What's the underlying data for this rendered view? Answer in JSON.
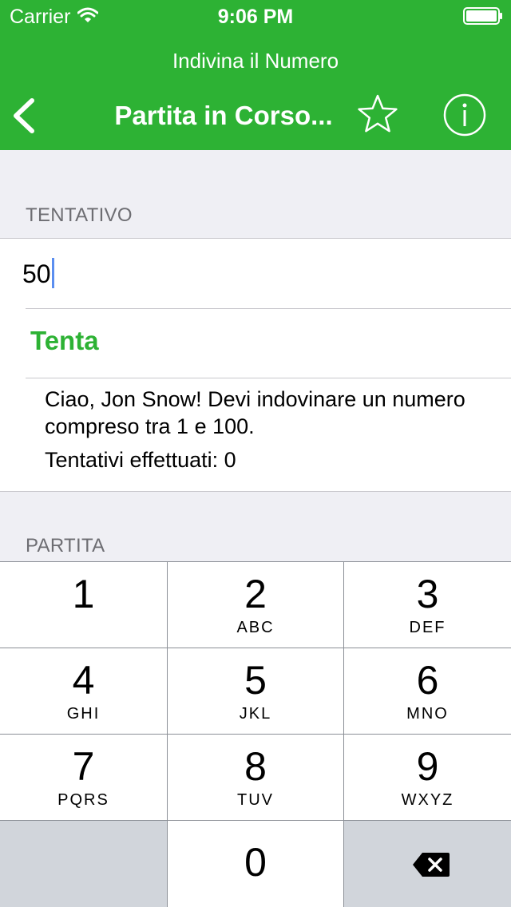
{
  "status_bar": {
    "carrier": "Carrier",
    "time": "9:06 PM",
    "icons": [
      "wifi-icon",
      "battery-icon"
    ]
  },
  "nav": {
    "app_title": "Indivina il Numero",
    "title": "Partita in Corso...",
    "back_icon": "chevron-left-icon",
    "actions": [
      "star-icon",
      "info-icon"
    ]
  },
  "sections": {
    "guess_header": "TENTATIVO",
    "game_header": "PARTITA"
  },
  "guess": {
    "value": "50",
    "button_label": "Tenta",
    "message": "Ciao, Jon Snow! Devi indovinare un numero compreso tra 1 e 100.",
    "attempts": "Tentativi effettuati: 0"
  },
  "keypad": {
    "keys": [
      {
        "digit": "1",
        "letters": ""
      },
      {
        "digit": "2",
        "letters": "ABC"
      },
      {
        "digit": "3",
        "letters": "DEF"
      },
      {
        "digit": "4",
        "letters": "GHI"
      },
      {
        "digit": "5",
        "letters": "JKL"
      },
      {
        "digit": "6",
        "letters": "MNO"
      },
      {
        "digit": "7",
        "letters": "PQRS"
      },
      {
        "digit": "8",
        "letters": "TUV"
      },
      {
        "digit": "9",
        "letters": "WXYZ"
      },
      {
        "digit": "0",
        "letters": ""
      }
    ],
    "delete_icon": "backspace-icon"
  },
  "colors": {
    "accent": "#2db234",
    "background": "#efeff4",
    "section_text": "#6d6d72",
    "keypad_dark_key": "#d1d5db"
  }
}
